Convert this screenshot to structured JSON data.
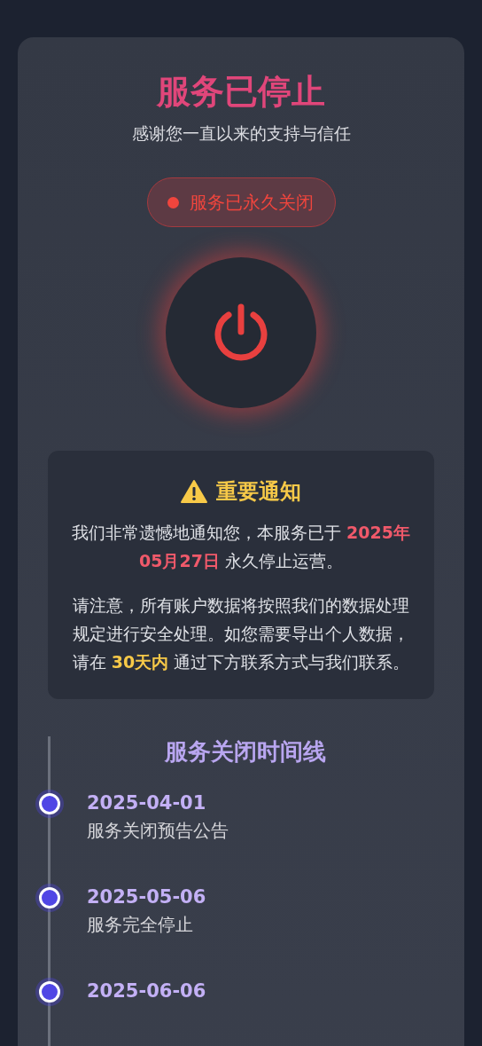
{
  "header": {
    "title": "服务已停止",
    "subtitle": "感谢您一直以来的支持与信任"
  },
  "status_badge": {
    "label": "服务已永久关闭"
  },
  "notice": {
    "title": "重要通知",
    "paragraphs": [
      {
        "kind": "date",
        "text": "我们非常遗憾地通知您，本服务已于 **2025年05月27日** 永久停止运营。"
      },
      {
        "kind": "deadline",
        "text": "请注意，所有账户数据将按照我们的数据处理规定进行安全处理。如您需要导出个人数据，请在 **30天内** 通过下方联系方式与我们联系。"
      }
    ]
  },
  "timeline": {
    "title": "服务关闭时间线",
    "events": [
      {
        "date": "2025-04-01",
        "description": "服务关闭预告公告"
      },
      {
        "date": "2025-05-06",
        "description": "服务完全停止"
      },
      {
        "date": "2025-06-06"
      }
    ]
  }
}
